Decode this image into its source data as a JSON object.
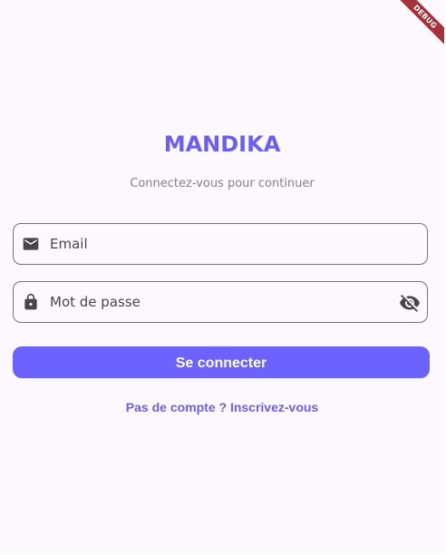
{
  "debug_banner": {
    "label": "DEBUG"
  },
  "header": {
    "title": "MANDIKA",
    "subtitle": "Connectez-vous pour continuer"
  },
  "form": {
    "email": {
      "label": "Email",
      "icon": "email-icon"
    },
    "password": {
      "label": "Mot de passe",
      "icon": "lock-icon",
      "toggle_icon": "visibility-off-icon"
    },
    "submit_label": "Se connecter",
    "signup_label": "Pas de compte ? Inscrivez-vous"
  },
  "colors": {
    "accent": "#6c63ff",
    "background": "#fdf7fe",
    "debug": "#a3323a"
  }
}
